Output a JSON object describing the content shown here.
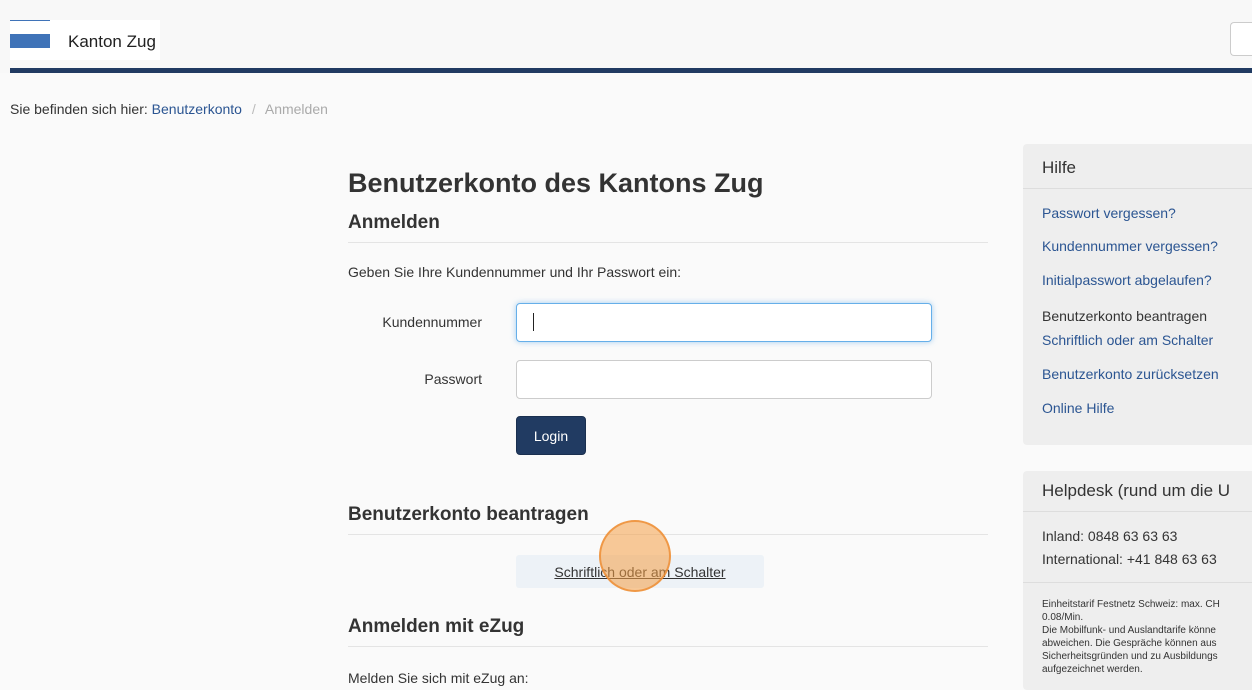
{
  "header": {
    "brand": "Kanton Zug"
  },
  "breadcrumb": {
    "prefix": "Sie befinden sich hier:",
    "link": "Benutzerkonto",
    "separator": "/",
    "current": "Anmelden"
  },
  "main": {
    "title": "Benutzerkonto des Kantons Zug",
    "login_section": "Anmelden",
    "intro": "Geben Sie Ihre Kundennummer und Ihr Passwort ein:",
    "kundennummer_label": "Kundennummer",
    "kundennummer_value": "",
    "passwort_label": "Passwort",
    "passwort_value": "",
    "login_button": "Login",
    "apply_section": "Benutzerkonto beantragen",
    "apply_button": "Schriftlich oder am Schalter",
    "ezug_section": "Anmelden mit eZug",
    "ezug_intro": "Melden Sie sich mit eZug an:"
  },
  "help": {
    "title": "Hilfe",
    "links": [
      "Passwort vergessen?",
      "Kundennummer vergessen?",
      "Initialpasswort abgelaufen?"
    ],
    "apply_text": "Benutzerkonto beantragen",
    "apply_link": "Schriftlich oder am Schalter",
    "reset_link": "Benutzerkonto zurücksetzen",
    "online_help": "Online Hilfe"
  },
  "helpdesk": {
    "title": "Helpdesk (rund um die U",
    "inland": "Inland: 0848 63 63 63",
    "international": "International: +41 848 63 63",
    "fineprint": [
      "Einheitstarif Festnetz Schweiz: max. CH",
      "0.08/Min.",
      "Die Mobilfunk- und Auslandtarife könne",
      "abweichen. Die Gespräche können aus",
      "Sicherheitsgründen und zu Ausbildungs",
      "aufgezeichnet werden."
    ]
  },
  "colors": {
    "brand_blue": "#3f73b8",
    "header_bar": "#213b62",
    "link": "#2b5592",
    "click_marker": "#f49f46"
  }
}
